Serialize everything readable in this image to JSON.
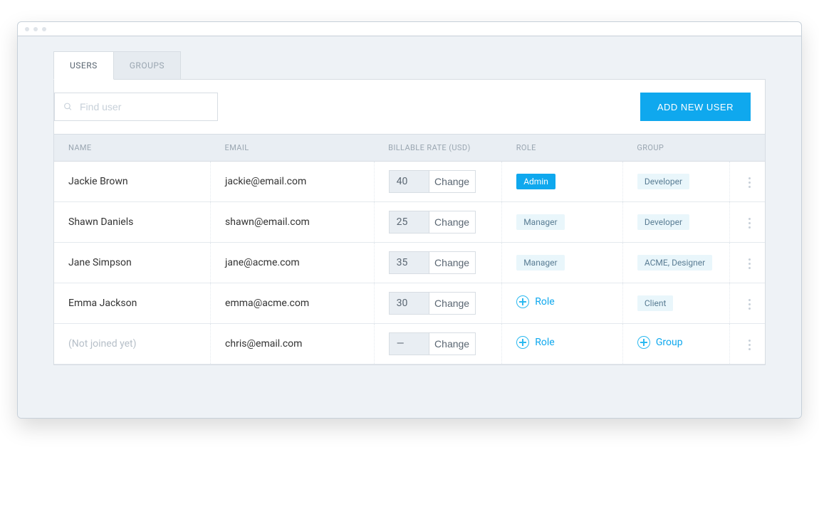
{
  "tabs": {
    "users": "USERS",
    "groups": "GROUPS"
  },
  "toolbar": {
    "search_placeholder": "Find user",
    "add_button": "ADD NEW USER"
  },
  "columns": {
    "name": "NAME",
    "email": "EMAIL",
    "rate": "BILLABLE RATE (USD)",
    "role": "ROLE",
    "group": "GROUP"
  },
  "rate_change_label": "Change",
  "add_role_label": "Role",
  "add_group_label": "Group",
  "rows": [
    {
      "name": "Jackie Brown",
      "email": "jackie@email.com",
      "rate": "40",
      "role": "Admin",
      "role_style": "admin",
      "group": "Developer"
    },
    {
      "name": "Shawn Daniels",
      "email": "shawn@email.com",
      "rate": "25",
      "role": "Manager",
      "role_style": "light",
      "group": "Developer"
    },
    {
      "name": "Jane Simpson",
      "email": "jane@acme.com",
      "rate": "35",
      "role": "Manager",
      "role_style": "light",
      "group": "ACME, Designer"
    },
    {
      "name": "Emma Jackson",
      "email": "emma@acme.com",
      "rate": "30",
      "role": null,
      "role_style": null,
      "group": "Client"
    },
    {
      "name": "(Not joined yet)",
      "email": "chris@email.com",
      "rate": "—",
      "role": null,
      "role_style": null,
      "group": null,
      "name_muted": true
    }
  ]
}
